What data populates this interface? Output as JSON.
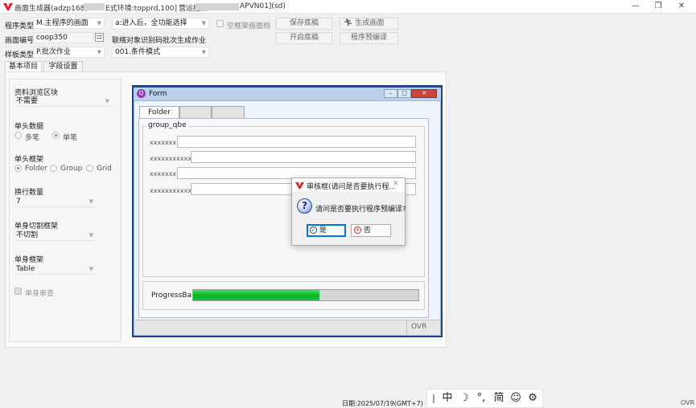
{
  "window": {
    "title_prefix": "画面生成器(adzp168)",
    "title_env": "E式环境:topprd,100]",
    "title_site_prefix": "营运据点",
    "title_site_suffix": "APVN01](sd)",
    "minimize": "—",
    "maximize": "❐",
    "close": "✕"
  },
  "header": {
    "program_type_label": "程序类型",
    "program_type_value": "M.主程序的画面",
    "entry_option_value": "a:进入后，全功能选择",
    "empty_frame_label": "空框架画面档",
    "save_draft_button": "保存底稿",
    "generate_screen_button": "生成画面",
    "screen_no_label": "画面编号",
    "screen_no_value": "coop350",
    "batch_label": "联络对象识别码批次生成作业",
    "open_draft_button": "开启底稿",
    "precompile_button": "程序预编译",
    "sample_type_label": "样板类型",
    "sample_type_value": "P.批次作业",
    "condition_mode_value": "001.条件模式"
  },
  "tabs": [
    "基本项目",
    "字段设置"
  ],
  "left_panel": {
    "browse_label": "资料浏览区块",
    "browse_value": "不需要",
    "single_head_label": "单头数据",
    "single_head_options": [
      "多笔",
      "单笔"
    ],
    "head_frame_label": "单头框架",
    "head_frame_options": [
      "Folder",
      "Group",
      "Grid"
    ],
    "row_count_label": "换行数量",
    "row_count_value": "7",
    "body_split_label": "单身切割框架",
    "body_split_value": "不切割",
    "body_frame_label": "单身框架",
    "body_frame_value": "Table",
    "body_serial_label": "单身串查"
  },
  "preview": {
    "title": "Form",
    "tabs": [
      "Folder",
      "",
      ""
    ],
    "group_label": "group_qbe",
    "fields": [
      "xxxxxxx",
      "xxxxxxxxxxx",
      "xxxxxxx",
      "xxxxxxxxxxx"
    ],
    "progress_label": "ProgressBar",
    "progress_fraction": 0.56,
    "status_ovr": "OVR"
  },
  "dialog": {
    "title": "审核框(请问是否要执行程...",
    "question_icon": "?",
    "message": "请问是否要执行程序预编译?",
    "yes_label": "是",
    "no_label": "否",
    "close": "✕"
  },
  "status_bar": {
    "date_text": "日期:2025/07/19(GMT+7)",
    "ovr": "OVR"
  },
  "ime": {
    "items": [
      "|",
      "中",
      "☽",
      "°,",
      "简",
      "☺",
      "⚙"
    ]
  },
  "colors": {
    "brand_red": "#d9262c",
    "progress_green": "#06b526",
    "preview_frame": "#1f4d8f",
    "default_button_border": "#0078d7"
  }
}
